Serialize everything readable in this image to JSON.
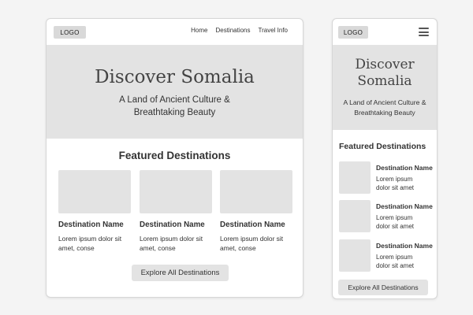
{
  "logo": "LOGO",
  "nav": [
    {
      "label": "Home"
    },
    {
      "label": "Destinations"
    },
    {
      "label": "Travel Info"
    }
  ],
  "hero": {
    "title": "Discover Somalia",
    "subtitle": "A Land of Ancient Culture & Breathtaking Beauty"
  },
  "featured": {
    "title": "Featured Destinations",
    "cards": [
      {
        "name": "Destination Name",
        "description": "Lorem ipsum dolor sit amet, conse"
      },
      {
        "name": "Destination Name",
        "description": "Lorem ipsum dolor sit amet, conse"
      },
      {
        "name": "Destination Name",
        "description": "Lorem ipsum dolor sit amet, conse"
      }
    ],
    "mobile_items": [
      {
        "name": "Destination Name",
        "description": "Lorem ipsum dolor sit amet"
      },
      {
        "name": "Destination Name",
        "description": "Lorem ipsum dolor sit amet"
      },
      {
        "name": "Destination Name",
        "description": "Lorem ipsum dolor sit amet"
      }
    ],
    "button_label": "Explore All Destinations"
  },
  "icons": {
    "menu": "hamburger-menu-icon"
  },
  "colors": {
    "placeholder": "#e3e3e3",
    "logo_bg": "#d9d9d9",
    "text": "#333333"
  }
}
